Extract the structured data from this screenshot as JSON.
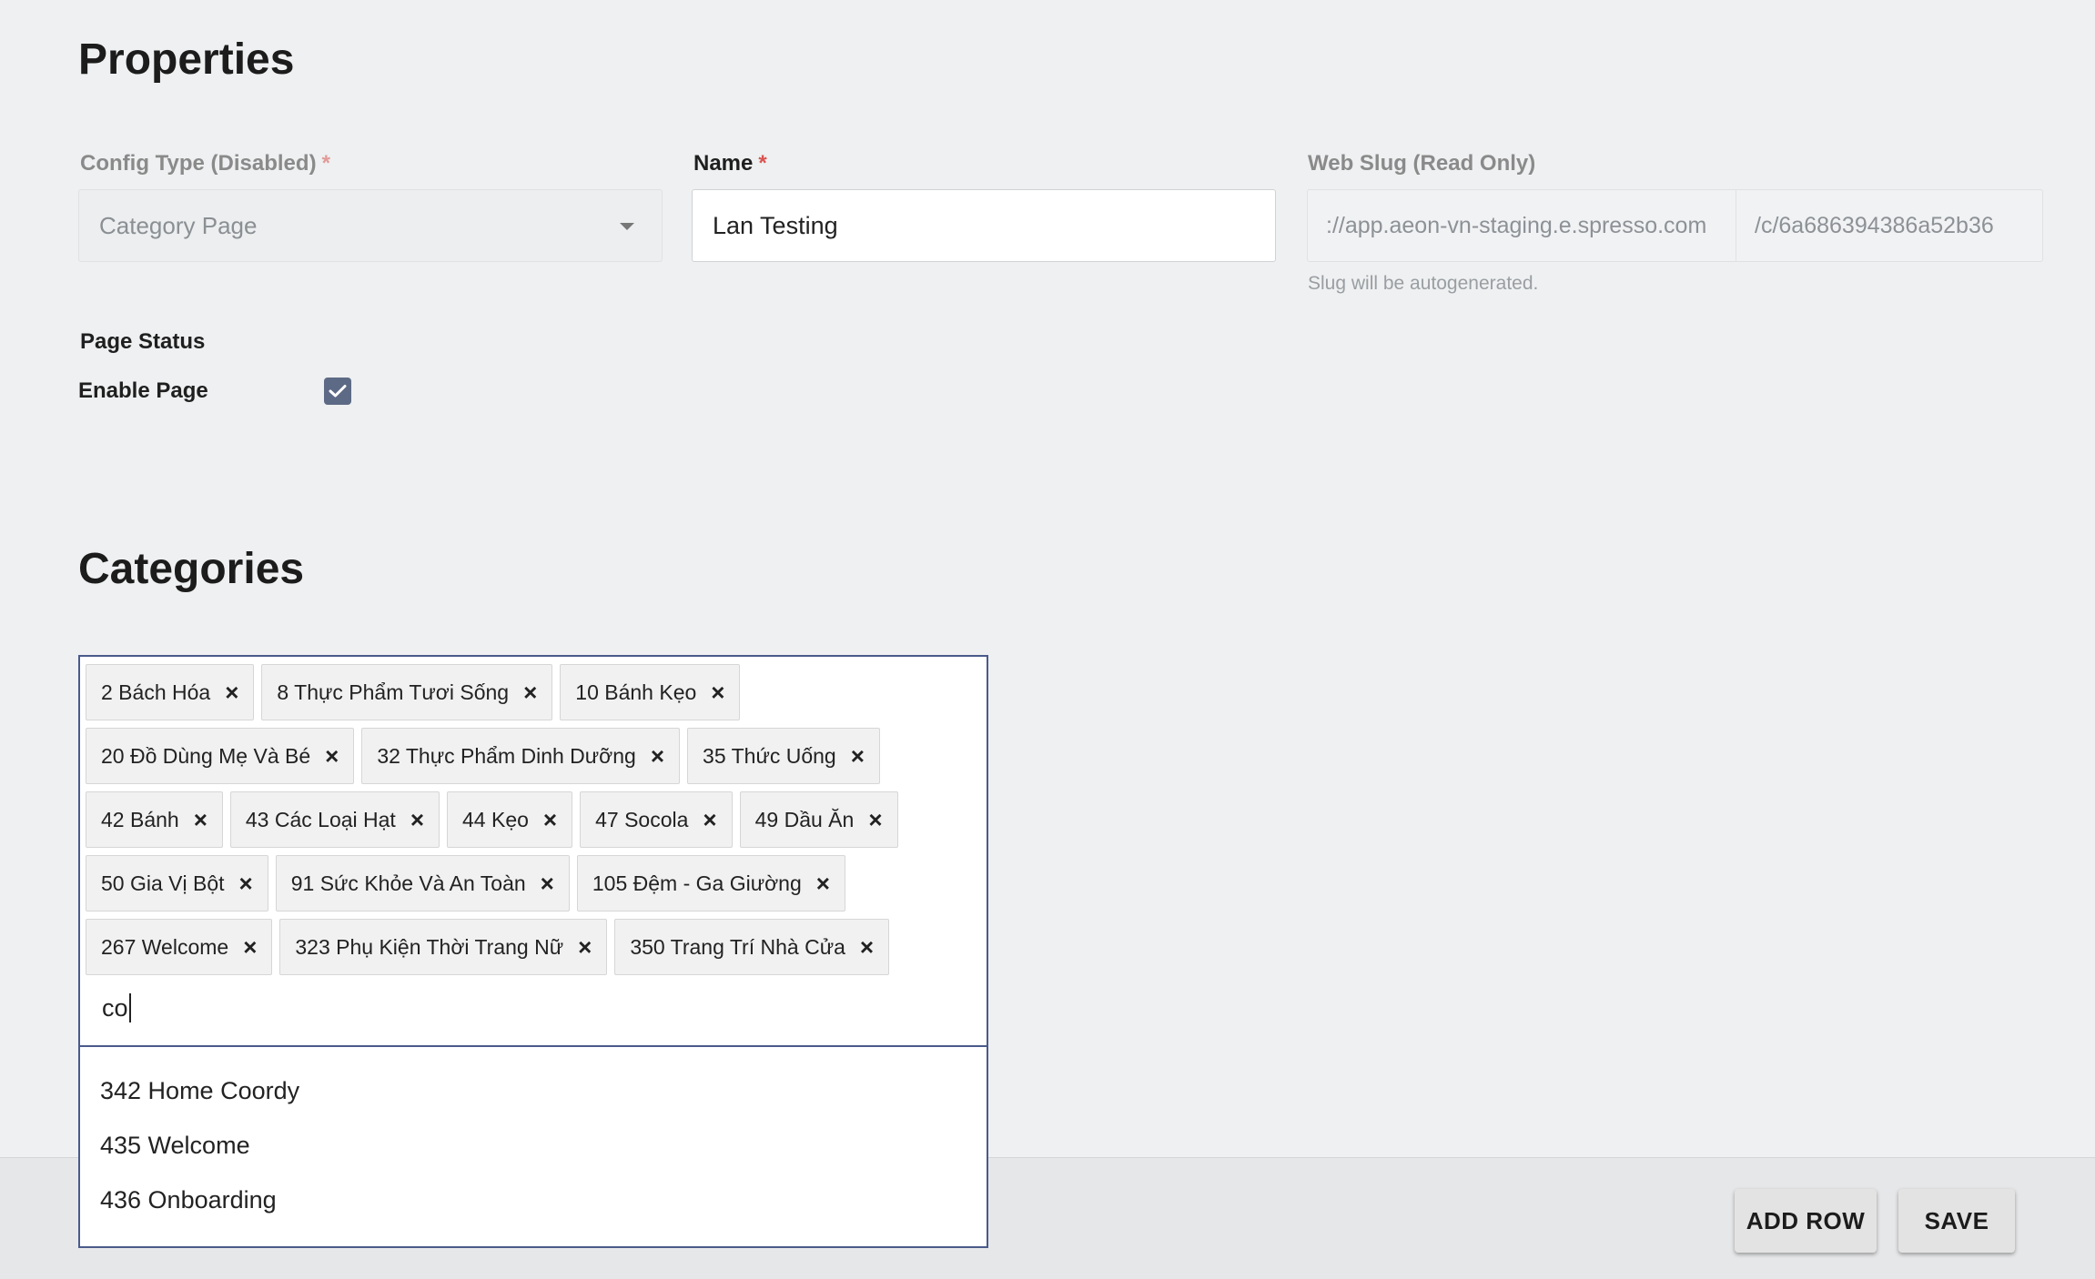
{
  "properties": {
    "title": "Properties",
    "config_type": {
      "label": "Config Type (Disabled)",
      "required_mark": "*",
      "value": "Category Page"
    },
    "name": {
      "label": "Name",
      "required_mark": "*",
      "value": "Lan Testing"
    },
    "web_slug": {
      "label": "Web Slug (Read Only)",
      "prefix": "://app.aeon-vn-staging.e.spresso.com",
      "path": "/c/6a686394386a52b36",
      "help": "Slug will be autogenerated."
    },
    "page_status": {
      "label": "Page Status",
      "enable_label": "Enable Page",
      "enabled": true
    }
  },
  "categories": {
    "title": "Categories",
    "tags": [
      [
        "2 Bách Hóa",
        "8 Thực Phẩm Tươi Sống",
        "10 Bánh Kẹo"
      ],
      [
        "20 Đồ Dùng Mẹ Và Bé",
        "32 Thực Phẩm Dinh Dưỡng",
        "35 Thức Uống"
      ],
      [
        "42 Bánh",
        "43 Các Loại Hạt",
        "44 Kẹo",
        "47 Socola",
        "49 Dầu Ăn"
      ],
      [
        "50 Gia Vị Bột",
        "91 Sức Khỏe Và An Toàn",
        "105 Đệm - Ga Giường"
      ],
      [
        "267 Welcome",
        "323 Phụ Kiện Thời Trang Nữ",
        "350 Trang Trí Nhà Cửa"
      ]
    ],
    "remove_glyph": "×",
    "search_value": "co",
    "options": [
      "342 Home Coordy",
      "435 Welcome",
      "436 Onboarding"
    ]
  },
  "footer": {
    "add_row_label": "ADD ROW",
    "save_label": "SAVE"
  },
  "colors": {
    "accent": "#4a5a8a",
    "checkbox": "#5d6a86",
    "required": "#d9534f"
  }
}
